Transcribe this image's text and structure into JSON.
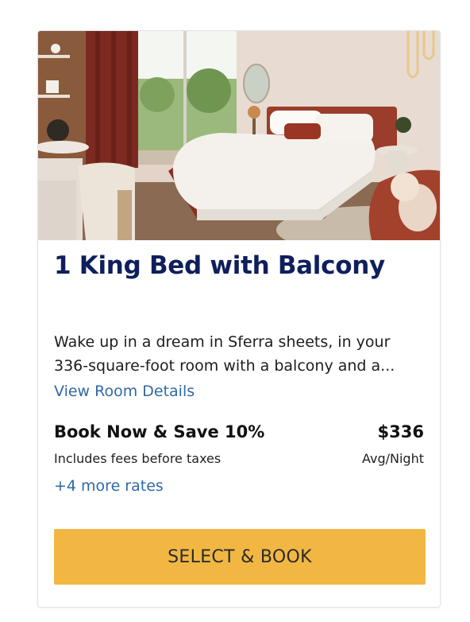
{
  "room": {
    "title": "1 King Bed with Balcony",
    "description_lines": [
      "Wake up in a dream in Sferra sheets, in your",
      "336-square-foot room with a balcony and a..."
    ],
    "details_link": "View Room Details"
  },
  "rate": {
    "name": "Book Now & Save 10%",
    "price": "$336",
    "fees_note": "Includes fees before taxes",
    "price_unit": "Avg/Night",
    "more_rates": "+4 more rates"
  },
  "actions": {
    "select_label": "SELECT & BOOK"
  },
  "colors": {
    "title": "#0f1f5c",
    "link": "#2f69a7",
    "button": "#f2b743"
  }
}
